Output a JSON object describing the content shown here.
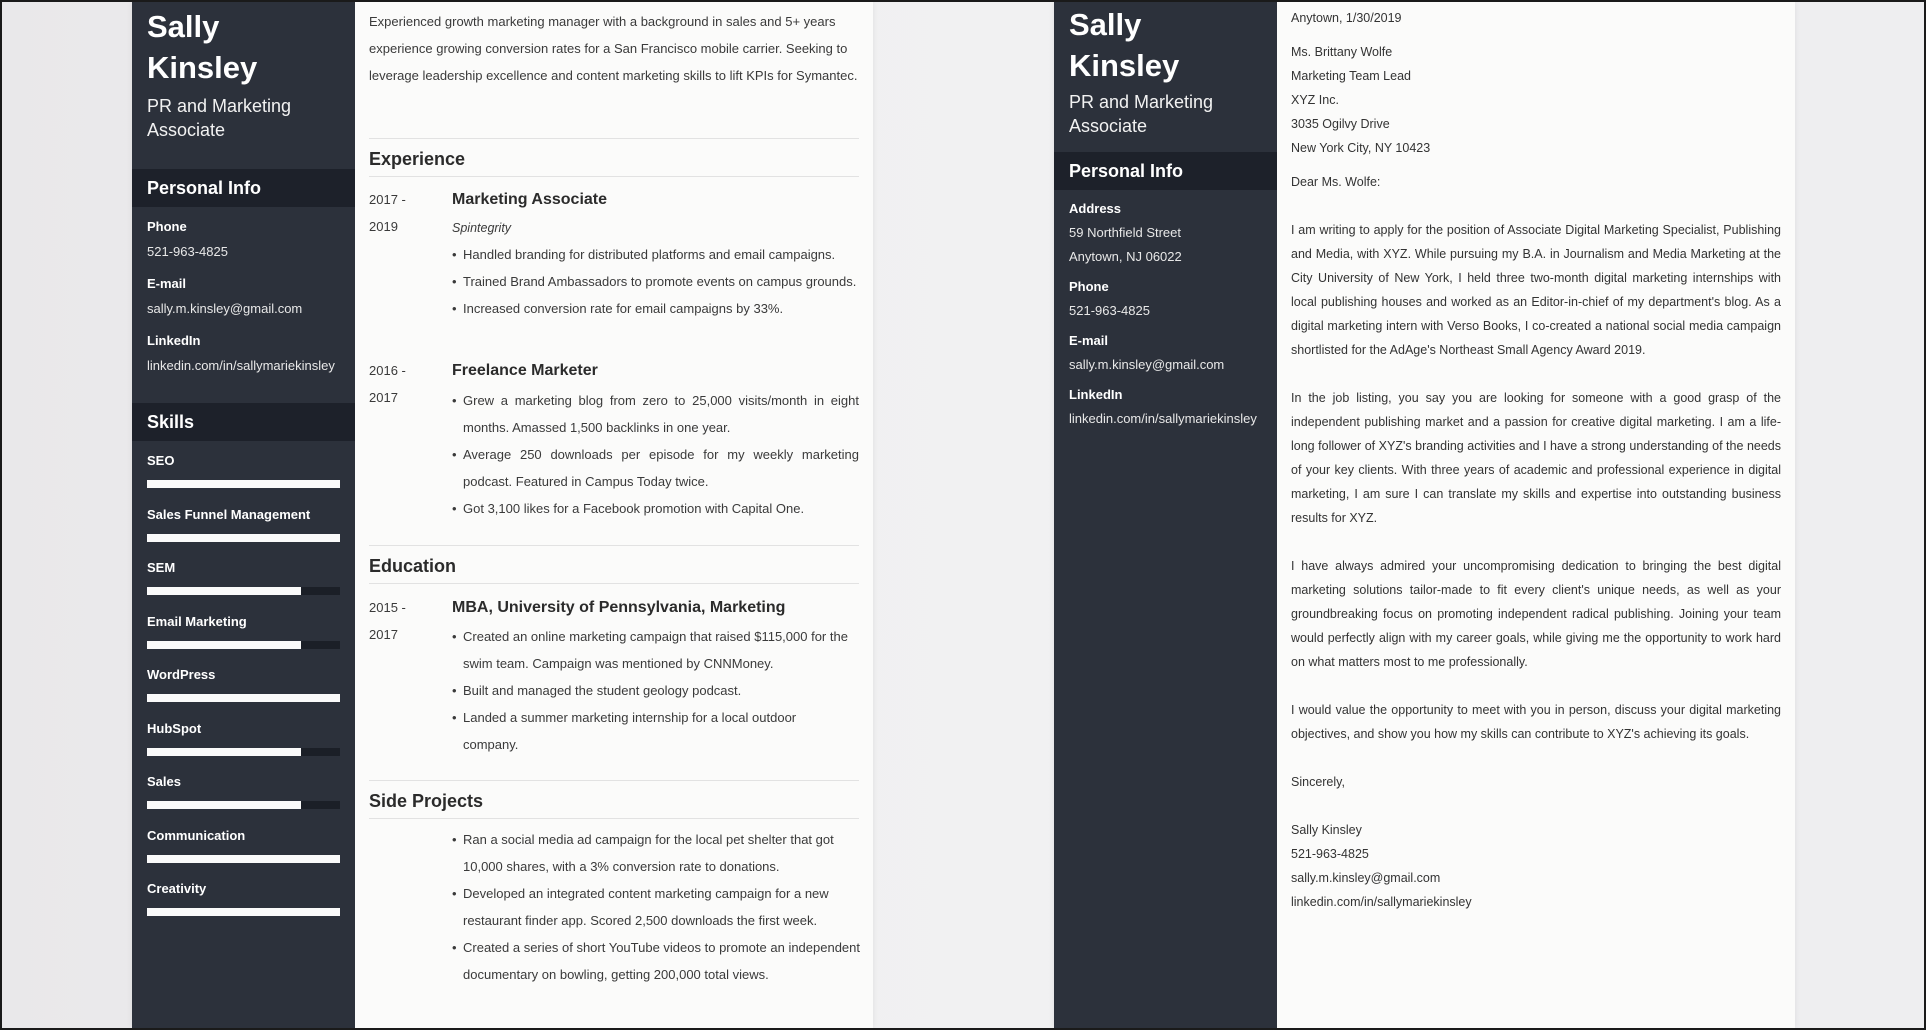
{
  "resume": {
    "name_first": "Sally",
    "name_last": "Kinsley",
    "role_line1": "PR and Marketing",
    "role_line2": "Associate",
    "personal_info": {
      "title": "Personal Info",
      "phone_label": "Phone",
      "phone": "521-963-4825",
      "email_label": "E-mail",
      "email": "sally.m.kinsley@gmail.com",
      "linkedin_label": "LinkedIn",
      "linkedin": "linkedin.com/in/sallymariekinsley"
    },
    "skills": {
      "title": "Skills",
      "items": [
        {
          "label": "SEO",
          "level": 1.0
        },
        {
          "label": "Sales Funnel Management",
          "level": 1.0
        },
        {
          "label": "SEM",
          "level": 0.8
        },
        {
          "label": "Email Marketing",
          "level": 0.8
        },
        {
          "label": "WordPress",
          "level": 1.0
        },
        {
          "label": "HubSpot",
          "level": 0.8
        },
        {
          "label": "Sales",
          "level": 0.8
        },
        {
          "label": "Communication",
          "level": 1.0
        },
        {
          "label": "Creativity",
          "level": 1.0
        }
      ]
    },
    "summary": "Experienced growth marketing manager with a background in sales and 5+ years experience growing conversion rates for a San Francisco mobile carrier. Seeking to leverage leadership excellence and content marketing skills to lift KPIs for Symantec.",
    "experience": {
      "title": "Experience",
      "entries": [
        {
          "years_start": "2017 -",
          "years_end": "2019",
          "title": "Marketing Associate",
          "company": "Spintegrity",
          "bullets": [
            "Handled branding for distributed platforms and email campaigns.",
            "Trained Brand Ambassadors to promote events on campus grounds.",
            "Increased conversion rate for email campaigns by 33%."
          ]
        },
        {
          "years_start": "2016 -",
          "years_end": "2017",
          "title": "Freelance Marketer",
          "bullets": [
            "Grew a marketing blog from zero to 25,000 visits/month in eight months. Amassed 1,500 backlinks in one year.",
            "Average 250 downloads per episode for my weekly marketing podcast. Featured in Campus Today twice.",
            "Got 3,100 likes for a Facebook promotion with Capital One."
          ]
        }
      ]
    },
    "education": {
      "title": "Education",
      "entries": [
        {
          "years_start": "2015 -",
          "years_end": "2017",
          "title": "MBA, University of Pennsylvania, Marketing",
          "bullets": [
            "Created an online marketing campaign that raised $115,000 for the swim team. Campaign was mentioned by CNNMoney.",
            "Built and managed the student geology podcast.",
            "Landed a summer marketing internship for a local outdoor company."
          ]
        }
      ]
    },
    "side_projects": {
      "title": "Side Projects",
      "bullets": [
        "Ran a social media ad campaign for the local pet shelter that got 10,000 shares, with a 3% conversion rate to donations.",
        "Developed an integrated content marketing campaign for a new restaurant finder app. Scored 2,500 downloads the first week.",
        "Created a series of short YouTube videos to promote an independent documentary on bowling, getting 200,000 total views."
      ]
    }
  },
  "cover_letter": {
    "name_first": "Sally",
    "name_last": "Kinsley",
    "role_line1": "PR and Marketing",
    "role_line2": "Associate",
    "personal_info": {
      "title": "Personal Info",
      "address_label": "Address",
      "address_line1": "59 Northfield Street",
      "address_line2": "Anytown, NJ 06022",
      "phone_label": "Phone",
      "phone": "521-963-4825",
      "email_label": "E-mail",
      "email": "sally.m.kinsley@gmail.com",
      "linkedin_label": "LinkedIn",
      "linkedin": "linkedin.com/in/sallymariekinsley"
    },
    "place_date": "Anytown, 1/30/2019",
    "recipient": [
      "Ms. Brittany Wolfe",
      "Marketing Team Lead",
      "XYZ Inc.",
      "3035 Ogilvy Drive",
      "New York City, NY 10423"
    ],
    "salutation": "Dear Ms. Wolfe:",
    "paragraphs": [
      "I am writing to apply for the position of Associate Digital Marketing Specialist, Publishing and Media, with XYZ. While pursuing my B.A. in Journalism and Media Marketing at the City University of New York, I held three two-month digital marketing internships with local publishing houses and worked as an Editor-in-chief of my department's blog. As a digital marketing intern with Verso Books, I co-created a national social media campaign shortlisted for the AdAge's Northeast Small Agency Award 2019.",
      "In the job listing, you say you are looking for someone with a good grasp of the independent publishing market and a passion for creative digital marketing. I am a life-long follower of XYZ's branding activities and I have a strong understanding of the needs of your key clients. With three years of academic and professional experience in digital marketing, I am sure I can translate my skills and expertise into outstanding business results for XYZ.",
      "I have always admired your uncompromising dedication to bringing the best digital marketing solutions tailor-made to fit every client's unique needs, as well as your groundbreaking focus on promoting independent radical publishing. Joining your team would perfectly align with my career goals, while giving me the opportunity to work hard on what matters most to me professionally.",
      "I would value the opportunity to meet with you in person, discuss your digital marketing objectives, and show you how my skills can contribute to XYZ's achieving its goals."
    ],
    "closing": "Sincerely,",
    "signature": [
      "Sally Kinsley",
      "521-963-4825",
      "sally.m.kinsley@gmail.com",
      "linkedin.com/in/sallymariekinsley"
    ]
  }
}
